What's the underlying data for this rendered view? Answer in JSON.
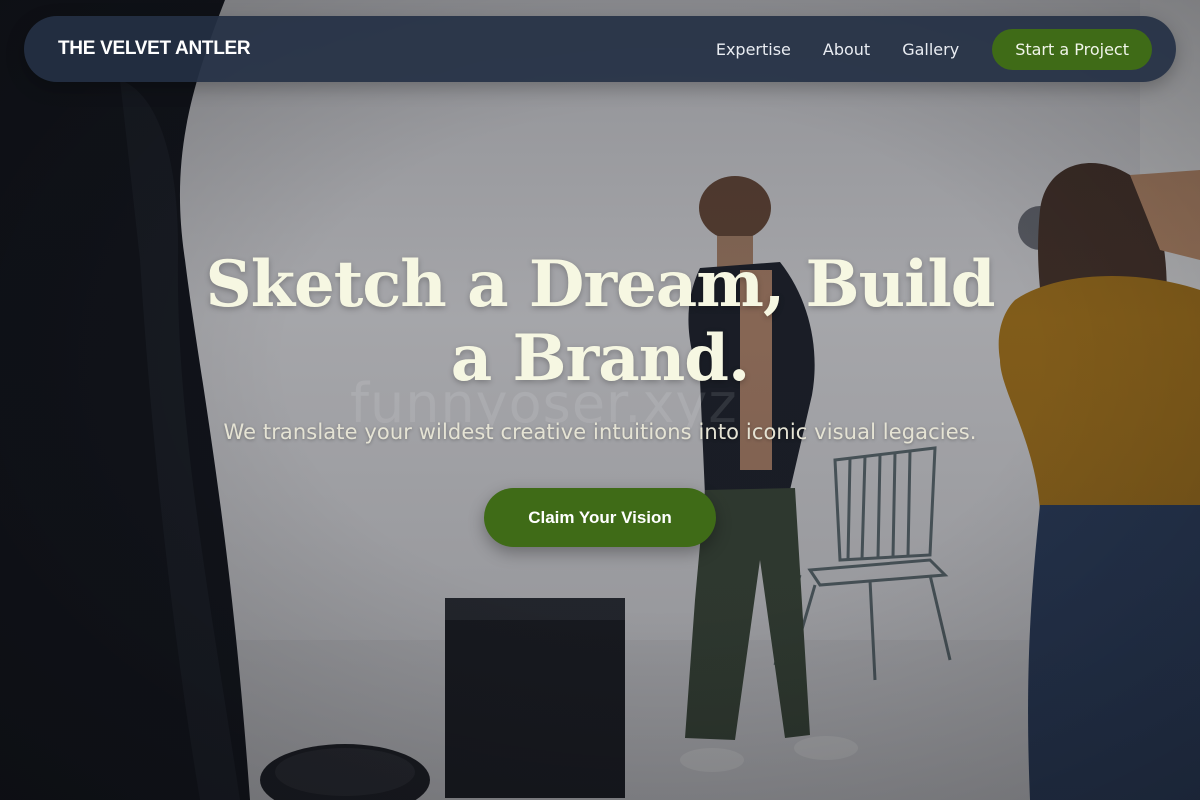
{
  "nav": {
    "brand": "THE VELVET ANTLER",
    "links": [
      "Expertise",
      "About",
      "Gallery"
    ],
    "cta_label": "Start a Project"
  },
  "hero": {
    "title": "Sketch a Dream, Build a Brand.",
    "subtitle": "We translate your wildest creative intuitions into iconic visual legacies.",
    "cta_label": "Claim Your Vision"
  },
  "watermark": "funnyoser.xyz",
  "colors": {
    "nav_background": "#243044",
    "accent_green": "#3f6b17",
    "title_cream": "#f6f7e2",
    "subtitle_text": "#e5e3d4"
  },
  "background": {
    "description_icon": "photo-studio-scene"
  }
}
